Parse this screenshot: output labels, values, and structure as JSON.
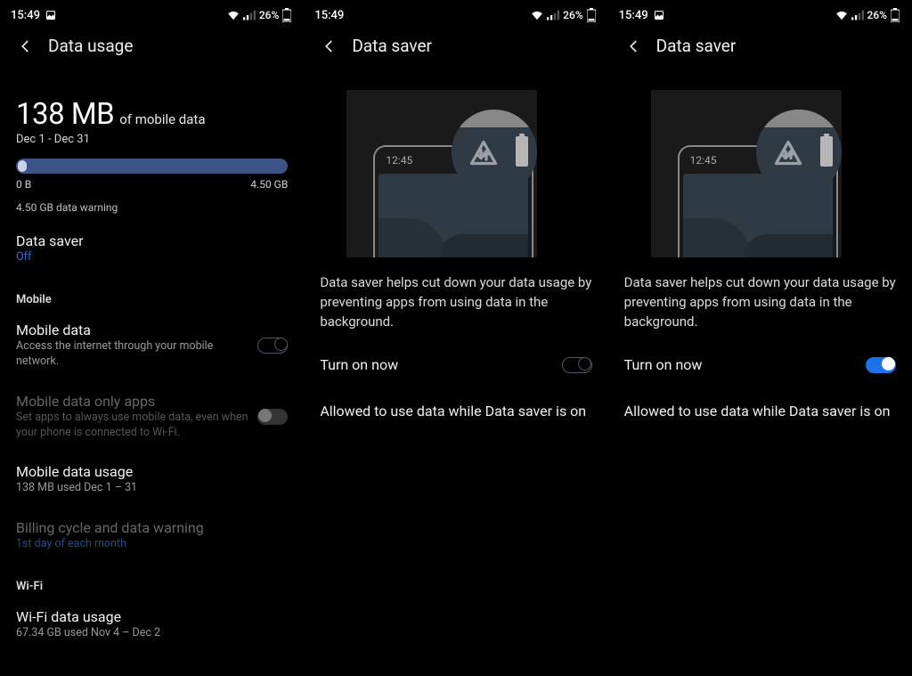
{
  "status": {
    "time": "15:49",
    "battery": "26%"
  },
  "icons": {
    "pic": "image-icon",
    "wifi": "wifi-icon",
    "signal": "signal-icon",
    "battery": "battery-icon",
    "back": "back-icon"
  },
  "screen1": {
    "title": "Data usage",
    "used_value": "138 MB",
    "used_label": "of mobile data",
    "period": "Dec 1 - Dec 31",
    "bar_min": "0 B",
    "bar_max": "4.50 GB",
    "warning": "4.50 GB data warning",
    "data_saver": {
      "title": "Data saver",
      "status": "Off"
    },
    "section_mobile": "Mobile",
    "mobile_data": {
      "title": "Mobile data",
      "sub": "Access the internet through your mobile network.",
      "on": false
    },
    "only_apps": {
      "title": "Mobile data only apps",
      "sub": "Set apps to always use mobile data, even when your phone is connected to Wi-Fi.",
      "on": false
    },
    "usage": {
      "title": "Mobile data usage",
      "sub": "138 MB used Dec 1 – 31"
    },
    "billing": {
      "title": "Billing cycle and data warning",
      "sub": "1st day of each month"
    },
    "section_wifi": "Wi-Fi",
    "wifi_usage": {
      "title": "Wi-Fi data usage",
      "sub": "67.34 GB used Nov 4 – Dec 2"
    }
  },
  "screen2": {
    "title": "Data saver",
    "phone_time": "12:45",
    "desc": "Data saver helps cut down your data usage by preventing apps from using data in the background.",
    "turn_on": "Turn on now",
    "turn_on_state": false,
    "allowed": "Allowed to use data while Data saver is on"
  },
  "screen3": {
    "title": "Data saver",
    "phone_time": "12:45",
    "desc": "Data saver helps cut down your data usage by preventing apps from using data in the background.",
    "turn_on": "Turn on now",
    "turn_on_state": true,
    "allowed": "Allowed to use data while Data saver is on"
  }
}
